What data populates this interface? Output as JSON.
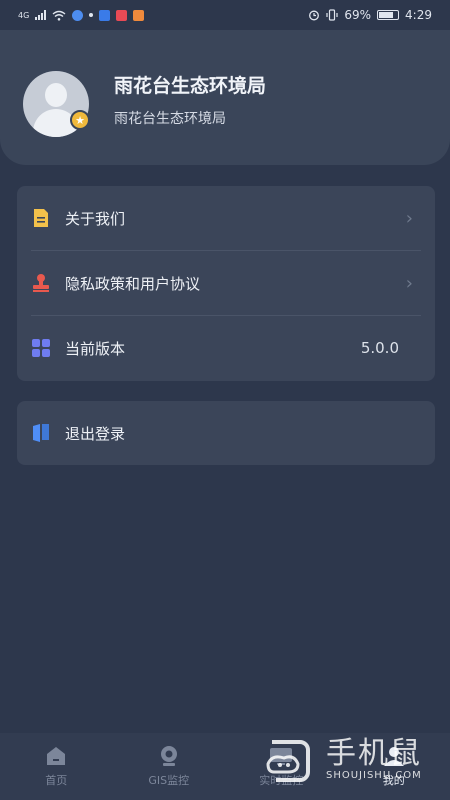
{
  "status_bar": {
    "network": "4G",
    "alarm_icon": "alarm-icon",
    "vibrate_icon": "vibrate-icon",
    "battery_percent": "69%",
    "time": "4:29"
  },
  "profile": {
    "name": "雨花台生态环境局",
    "subtitle": "雨花台生态环境局",
    "avatar_icon": "person-icon",
    "badge_icon": "star-icon"
  },
  "menu": {
    "items": [
      {
        "label": "关于我们",
        "icon": "document-icon",
        "icon_color": "#f3c14b"
      },
      {
        "label": "隐私政策和用户协议",
        "icon": "stamp-icon",
        "icon_color": "#e8594e"
      },
      {
        "label": "当前版本",
        "value": "5.0.0",
        "icon": "grid-icon",
        "icon_color": "#6f7cf0"
      }
    ],
    "chevron": "›"
  },
  "logout": {
    "label": "退出登录",
    "icon": "book-icon",
    "icon_color": "#4f8ef7"
  },
  "tabs": [
    {
      "label": "首页",
      "icon": "home-icon"
    },
    {
      "label": "GIS监控",
      "icon": "camera-icon"
    },
    {
      "label": "实时监控",
      "icon": "monitor-icon"
    },
    {
      "label": "我的",
      "icon": "user-icon",
      "active": true
    }
  ],
  "watermark": {
    "title": "手机鼠",
    "url": "SHOUJISHU.COM"
  }
}
